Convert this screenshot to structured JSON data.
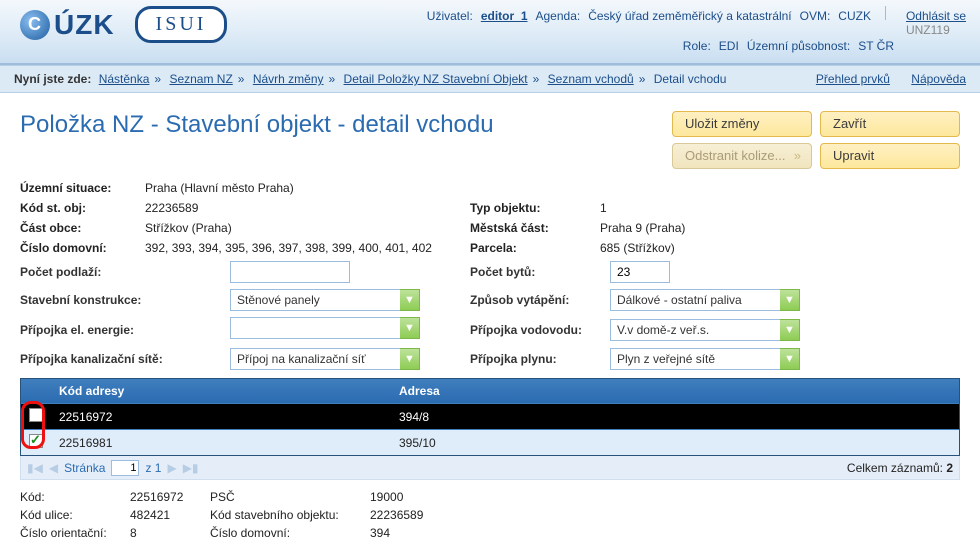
{
  "header": {
    "logo_cuzk_letter": "C",
    "logo_cuzk_text": "ÚZK",
    "logo_isui": "ISUI",
    "user_label": "Uživatel:",
    "user_value": "editor_1",
    "agenda_label": "Agenda:",
    "agenda_value": "Český úřad zeměměřický a katastrální",
    "ovm_label": "OVM:",
    "ovm_value": "CUZK",
    "logout": "Odhlásit se",
    "role_label": "Role:",
    "role_value": "EDI",
    "scope_label": "Územní působnost:",
    "scope_value": "ST ČR",
    "unit_code": "UNZ119"
  },
  "breadcrumb": {
    "prefix": "Nyní jste zde:",
    "items": [
      "Nástěnka",
      "Seznam NZ",
      "Návrh změny",
      "Detail Položky NZ Stavební Objekt",
      "Seznam vchodů",
      "Detail vchodu"
    ],
    "right_links": [
      "Přehled prvků",
      "Nápověda"
    ]
  },
  "title": "Položka NZ - Stavební objekt - detail vchodu",
  "buttons": {
    "save": "Uložit změny",
    "close": "Zavřít",
    "remove": "Odstranit kolize...",
    "edit": "Upravit"
  },
  "details": {
    "left": {
      "uzemni_situace_lbl": "Územní situace:",
      "uzemni_situace_val": "Praha (Hlavní město Praha)",
      "kod_st_obj_lbl": "Kód st. obj:",
      "kod_st_obj_val": "22236589",
      "cast_obce_lbl": "Část obce:",
      "cast_obce_val": "Střížkov (Praha)",
      "cislo_dom_lbl": "Číslo domovní:",
      "cislo_dom_val": "392, 393, 394, 395, 396, 397, 398, 399, 400, 401, 402"
    },
    "right": {
      "typ_obj_lbl": "Typ objektu:",
      "typ_obj_val": "1",
      "mestska_cast_lbl": "Městská část:",
      "mestska_cast_val": "Praha 9 (Praha)",
      "parcela_lbl": "Parcela:",
      "parcela_val": "685 (Střížkov)"
    }
  },
  "form": {
    "pocet_podlazi_lbl": "Počet podlaží:",
    "pocet_podlazi_val": "",
    "pocet_bytu_lbl": "Počet bytů:",
    "pocet_bytu_val": "23",
    "stav_konstr_lbl": "Stavební konstrukce:",
    "stav_konstr_val": "Stěnové panely",
    "zpusob_vytapeni_lbl": "Způsob vytápění:",
    "zpusob_vytapeni_val": "Dálkové - ostatní paliva",
    "prip_el_lbl": "Přípojka el. energie:",
    "prip_el_val": "",
    "prip_vod_lbl": "Přípojka vodovodu:",
    "prip_vod_val": "V.v domě-z veř.s.",
    "prip_kan_lbl": "Přípojka kanalizační sítě:",
    "prip_kan_val": "Přípoj na kanalizační síť",
    "prip_plyn_lbl": "Přípojka plynu:",
    "prip_plyn_val": "Plyn z veřejné sítě"
  },
  "table": {
    "headers": {
      "code": "Kód adresy",
      "addr": "Adresa"
    },
    "rows": [
      {
        "checked": false,
        "selected": true,
        "code": "22516972",
        "addr": "394/8"
      },
      {
        "checked": true,
        "selected": false,
        "code": "22516981",
        "addr": "395/10"
      }
    ]
  },
  "pager": {
    "label": "Stránka",
    "page": "1",
    "of": "z 1",
    "total_label": "Celkem záznamů:",
    "total_value": "2"
  },
  "bottom": {
    "kod_lbl": "Kód:",
    "kod_val": "22516972",
    "psc_lbl": "PSČ",
    "psc_val": "19000",
    "kod_ulice_lbl": "Kód ulice:",
    "kod_ulice_val": "482421",
    "kod_so_lbl": "Kód stavebního objektu:",
    "kod_so_val": "22236589",
    "cislo_or_lbl": "Číslo orientační:",
    "cislo_or_val": "8",
    "cislo_dom_lbl": "Číslo domovní:",
    "cislo_dom_val": "394"
  }
}
